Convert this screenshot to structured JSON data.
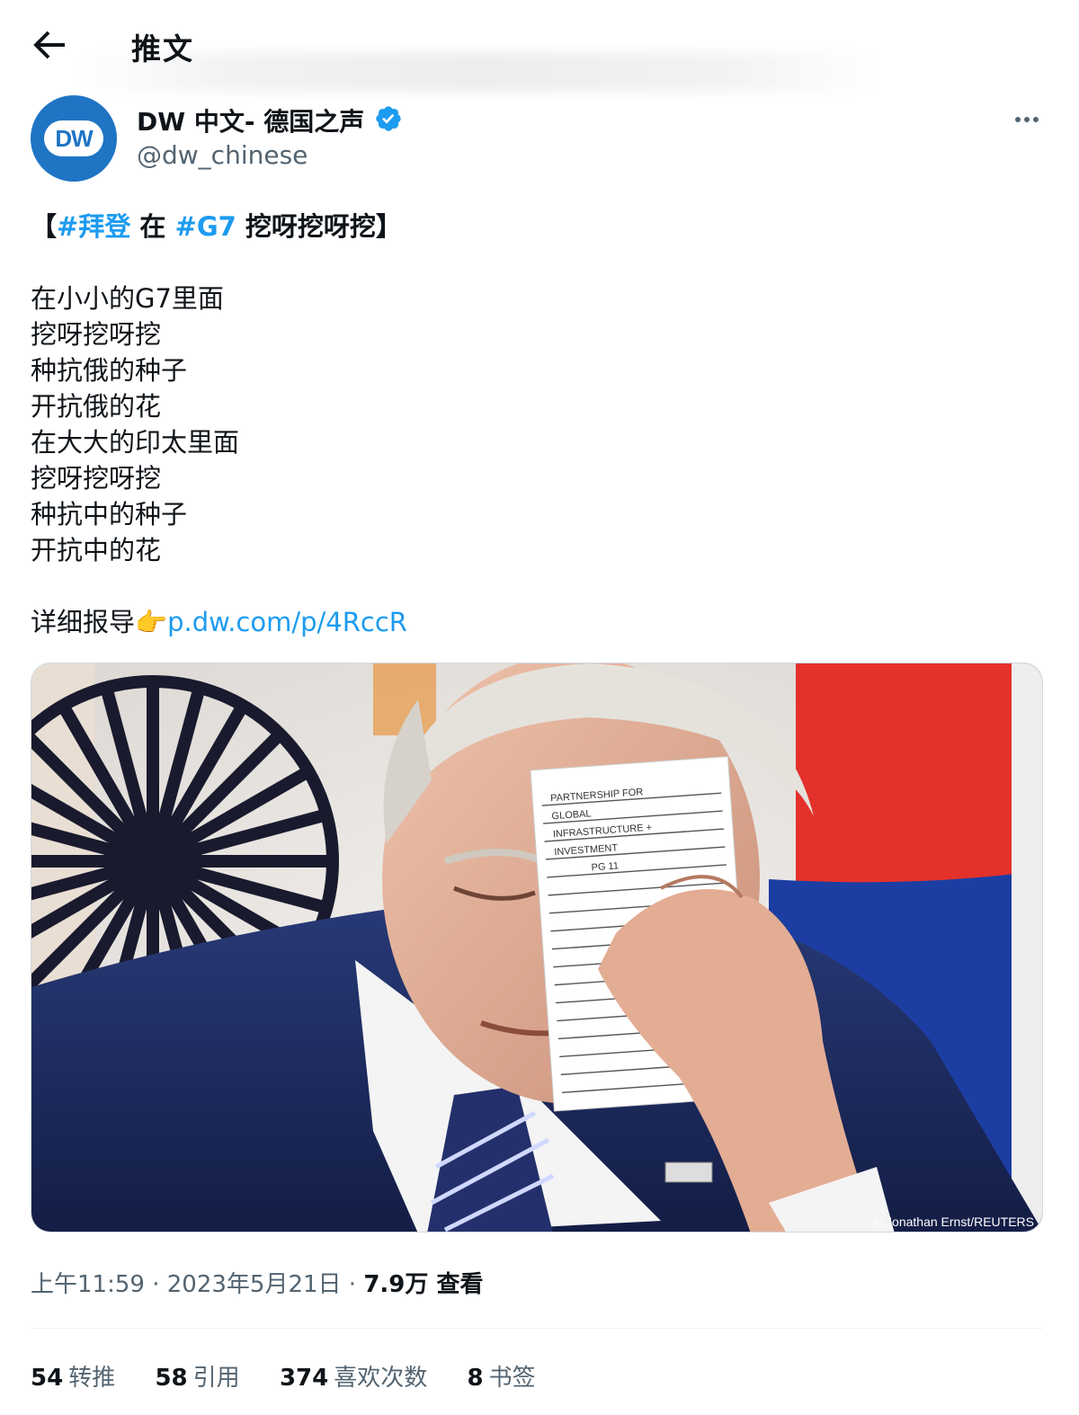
{
  "header": {
    "title": "推文"
  },
  "author": {
    "avatar_text": "DW",
    "name": "DW 中文- 德国之声",
    "handle": "@dw_chinese",
    "verified": true
  },
  "tweet": {
    "title_line": {
      "open_bracket": "【",
      "hashtag1": "#拜登",
      "mid": " 在 ",
      "hashtag2": "#G7",
      "tail": " 挖呀挖呀挖】"
    },
    "lines": [
      "在小小的G7里面",
      "挖呀挖呀挖",
      "种抗俄的种子",
      "开抗俄的花",
      "在大大的印太里面",
      "挖呀挖呀挖",
      "种抗中的种子",
      "开抗中的花"
    ],
    "detail_prefix": "详细报导👉",
    "link": "p.dw.com/p/4RccR",
    "media_credit": "© Jonathan Ernst/REUTERS",
    "note_lines": [
      "PARTNERSHIP FOR",
      "GLOBAL",
      "INFRASTRUCTURE +",
      "INVESTMENT",
      "PG 11"
    ]
  },
  "meta": {
    "time": "上午11:59",
    "sep1": " · ",
    "date": "2023年5月21日",
    "sep2": " · ",
    "views_count": "7.9万",
    "views_label": " 查看"
  },
  "stats": {
    "retweets": {
      "count": "54",
      "label": "转推"
    },
    "quotes": {
      "count": "58",
      "label": "引用"
    },
    "likes": {
      "count": "374",
      "label": "喜欢次数"
    },
    "bookmarks": {
      "count": "8",
      "label": "书签"
    }
  },
  "colors": {
    "link": "#1d9bf0",
    "secondary_text": "#536471",
    "verified_badge": "#1d9bf0",
    "dw_blue": "#1f74c4"
  },
  "icons": {
    "back": "arrow-left-icon",
    "verified": "verified-badge-icon",
    "more": "more-horizontal-icon"
  }
}
